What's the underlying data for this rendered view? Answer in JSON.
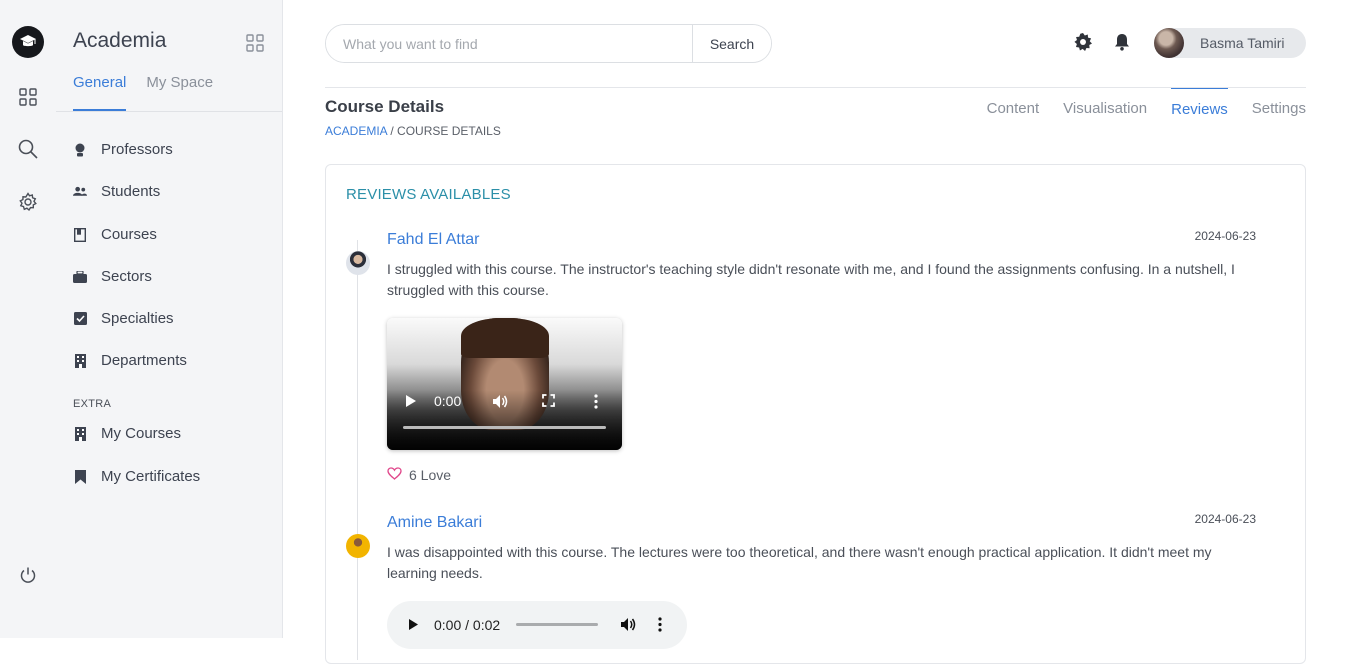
{
  "app": {
    "brand": "Academia"
  },
  "sidebar": {
    "tabs": [
      {
        "label": "General"
      },
      {
        "label": "My Space"
      }
    ],
    "items": [
      {
        "label": "Professors",
        "icon": "professor-icon"
      },
      {
        "label": "Students",
        "icon": "students-icon"
      },
      {
        "label": "Courses",
        "icon": "courses-icon"
      },
      {
        "label": "Sectors",
        "icon": "sectors-icon"
      },
      {
        "label": "Specialties",
        "icon": "specialties-icon"
      },
      {
        "label": "Departments",
        "icon": "departments-icon"
      }
    ],
    "extra_label": "EXTRA",
    "extra_items": [
      {
        "label": "My Courses",
        "icon": "building-icon"
      },
      {
        "label": "My Certificates",
        "icon": "bookmark-icon"
      }
    ]
  },
  "header": {
    "search_placeholder": "What you want to find",
    "search_button": "Search",
    "user_name": "Basma Tamiri"
  },
  "page": {
    "title": "Course Details",
    "breadcrumb_root": "ACADEMIA",
    "breadcrumb_sep": " / ",
    "breadcrumb_current": "COURSE DETAILS",
    "tabs": [
      {
        "label": "Content"
      },
      {
        "label": "Visualisation"
      },
      {
        "label": "Reviews"
      },
      {
        "label": "Settings"
      }
    ],
    "active_tab": "Reviews"
  },
  "reviews": {
    "section_title": "REVIEWS AVAILABLES",
    "items": [
      {
        "author": "Fahd El Attar",
        "date": "2024-06-23",
        "text": "I struggled with this course. The instructor's teaching style didn't resonate with me, and I found the assignments confusing. In a nutshell, I struggled with this course.",
        "media": "video",
        "video_time": "0:00",
        "love_count": "6 Love"
      },
      {
        "author": "Amine Bakari",
        "date": "2024-06-23",
        "text": "I was disappointed with this course. The lectures were too theoretical, and there wasn't enough practical application. It didn't meet my learning needs.",
        "media": "audio",
        "audio_time": "0:00 / 0:02"
      }
    ]
  },
  "colors": {
    "accent": "#3b7dd8",
    "section_title": "#2b8fa8",
    "love": "#e0468a"
  }
}
